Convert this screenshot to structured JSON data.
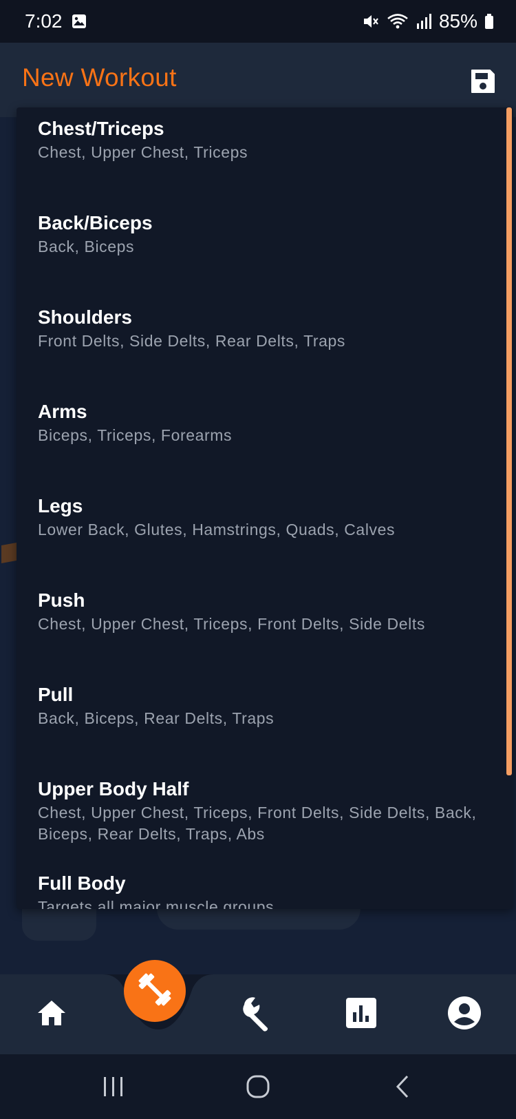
{
  "status_bar": {
    "time": "7:02",
    "battery": "85%",
    "icons": [
      "image-icon",
      "mute-icon",
      "wifi-icon",
      "signal-icon",
      "battery-icon"
    ]
  },
  "header": {
    "title": "New Workout",
    "save_icon": "save-icon"
  },
  "workouts": [
    {
      "name": "Chest/Triceps",
      "muscles": "Chest, Upper Chest, Triceps"
    },
    {
      "name": "Back/Biceps",
      "muscles": "Back, Biceps"
    },
    {
      "name": "Shoulders",
      "muscles": "Front Delts, Side Delts, Rear Delts, Traps"
    },
    {
      "name": "Arms",
      "muscles": "Biceps, Triceps, Forearms"
    },
    {
      "name": "Legs",
      "muscles": "Lower Back, Glutes, Hamstrings, Quads, Calves"
    },
    {
      "name": "Push",
      "muscles": "Chest, Upper Chest, Triceps, Front Delts, Side Delts"
    },
    {
      "name": "Pull",
      "muscles": "Back, Biceps, Rear Delts, Traps"
    },
    {
      "name": "Upper Body Half",
      "muscles": "Chest, Upper Chest, Triceps, Front Delts, Side Delts, Back, Biceps, Rear Delts, Traps, Abs"
    },
    {
      "name": "Full Body",
      "muscles": "Targets all major muscle groups"
    }
  ],
  "bottom_nav": {
    "items": [
      "home-icon",
      "dumbbell-icon",
      "wrench-icon",
      "chart-icon",
      "profile-icon"
    ],
    "active": "dumbbell-icon"
  },
  "colors": {
    "accent": "#f97316",
    "background": "#111827",
    "header": "#1e293b",
    "muted_text": "#9ca3af"
  }
}
